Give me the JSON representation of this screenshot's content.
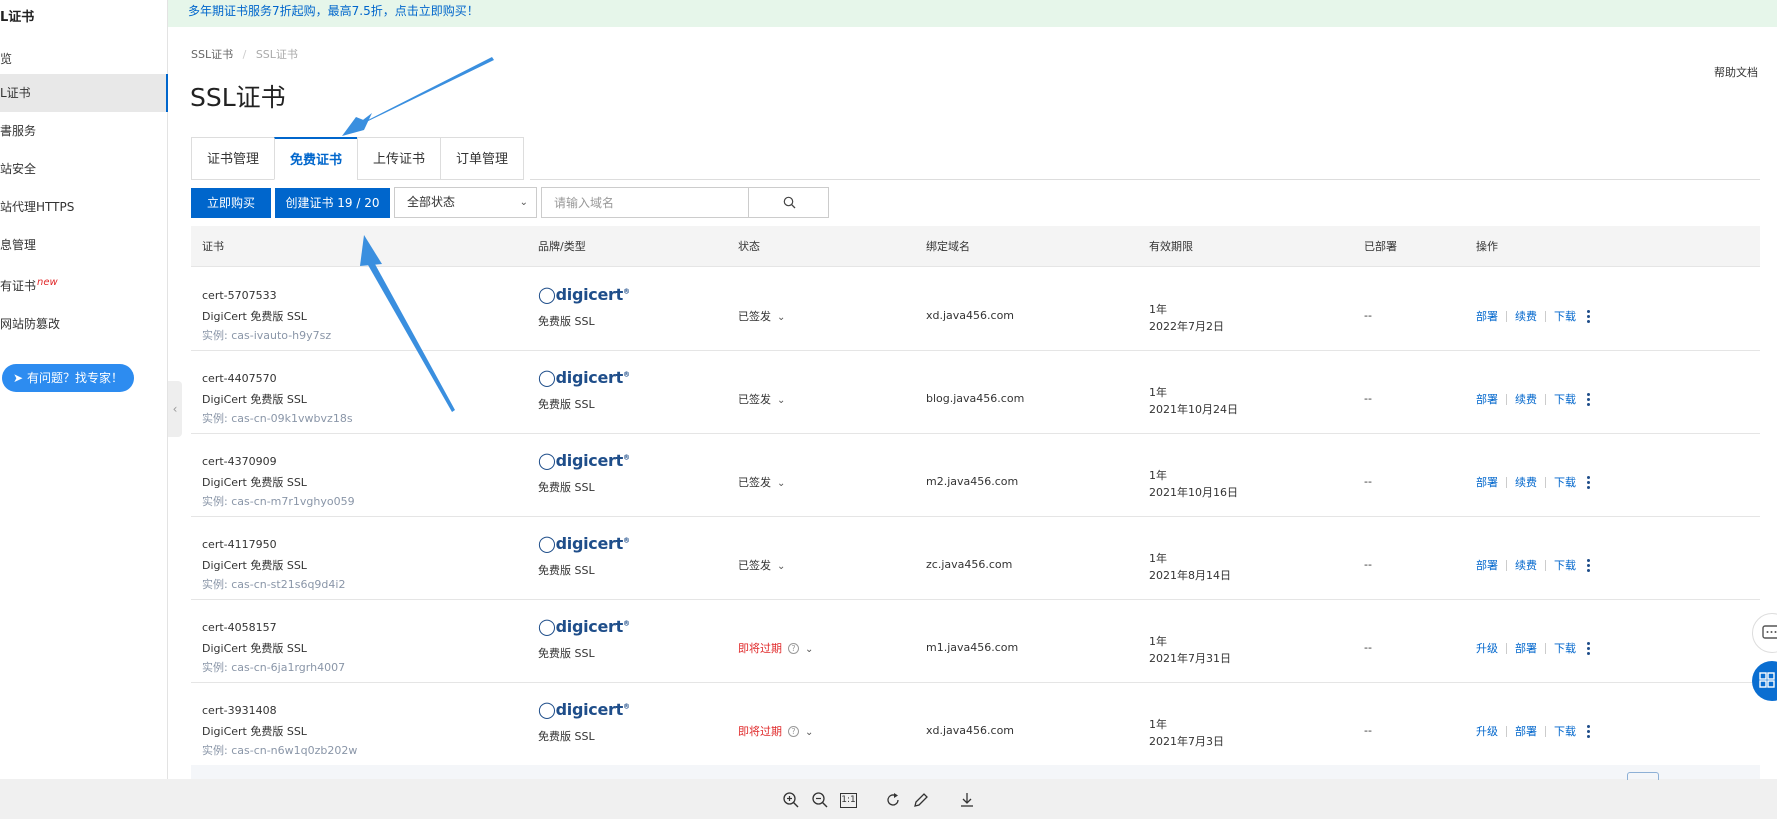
{
  "sidebar": {
    "title": "L证书",
    "items": [
      {
        "label": "览"
      },
      {
        "label": "L证书"
      },
      {
        "label": "書服务"
      },
      {
        "label": "站安全"
      },
      {
        "label": "站代理HTTPS"
      },
      {
        "label": "息管理"
      },
      {
        "label": "有证书",
        "badge": "new"
      },
      {
        "label": "网站防篡改"
      }
    ],
    "help_button": "有问题？找专家！"
  },
  "promo": {
    "text": "多年期证书服务7折起购，最高7.5折，点击立即购买！"
  },
  "breadcrumb": {
    "root": "SSL证书",
    "sep": "/",
    "current": "SSL证书"
  },
  "page": {
    "title": "SSL证书",
    "help_doc": "帮助文档"
  },
  "tabs": [
    {
      "label": "证书管理"
    },
    {
      "label": "免费证书"
    },
    {
      "label": "上传证书"
    },
    {
      "label": "订单管理"
    }
  ],
  "toolbar": {
    "buy_button": "立即购买",
    "create_button": "创建证书 19 / 20",
    "status_select": "全部状态",
    "search_placeholder": "请输入域名"
  },
  "table": {
    "headers": [
      "证书",
      "品牌/类型",
      "状态",
      "绑定域名",
      "有效期限",
      "已部署",
      "操作"
    ],
    "rows": [
      {
        "id": "cert-5707533",
        "brand": "DigiCert 免费版 SSL",
        "instance": "实例: cas-ivauto-h9y7sz",
        "logo": "digicert",
        "type": "免费版 SSL",
        "status": "已签发",
        "warn": false,
        "domain": "xd.java456.com",
        "period": "1年",
        "expiry": "2022年7月2日",
        "deployed": "--",
        "ops": [
          "部署",
          "续费",
          "下载"
        ]
      },
      {
        "id": "cert-4407570",
        "brand": "DigiCert 免费版 SSL",
        "instance": "实例: cas-cn-09k1vwbvz18s",
        "logo": "digicert",
        "type": "免费版 SSL",
        "status": "已签发",
        "warn": false,
        "domain": "blog.java456.com",
        "period": "1年",
        "expiry": "2021年10月24日",
        "deployed": "--",
        "ops": [
          "部署",
          "续费",
          "下载"
        ]
      },
      {
        "id": "cert-4370909",
        "brand": "DigiCert 免费版 SSL",
        "instance": "实例: cas-cn-m7r1vghyo059",
        "logo": "digicert",
        "type": "免费版 SSL",
        "status": "已签发",
        "warn": false,
        "domain": "m2.java456.com",
        "period": "1年",
        "expiry": "2021年10月16日",
        "deployed": "--",
        "ops": [
          "部署",
          "续费",
          "下载"
        ]
      },
      {
        "id": "cert-4117950",
        "brand": "DigiCert 免费版 SSL",
        "instance": "实例: cas-cn-st21s6q9d4i2",
        "logo": "digicert",
        "type": "免费版 SSL",
        "status": "已签发",
        "warn": false,
        "domain": "zc.java456.com",
        "period": "1年",
        "expiry": "2021年8月14日",
        "deployed": "--",
        "ops": [
          "部署",
          "续费",
          "下载"
        ]
      },
      {
        "id": "cert-4058157",
        "brand": "DigiCert 免费版 SSL",
        "instance": "实例: cas-cn-6ja1rgrh4007",
        "logo": "digicert",
        "type": "免费版 SSL",
        "status": "即将过期",
        "warn": true,
        "domain": "m1.java456.com",
        "period": "1年",
        "expiry": "2021年7月31日",
        "deployed": "--",
        "ops": [
          "升级",
          "部署",
          "下载"
        ]
      },
      {
        "id": "cert-3931408",
        "brand": "DigiCert 免费版 SSL",
        "instance": "实例: cas-cn-n6w1q0zb202w",
        "logo": "digicert",
        "type": "免费版 SSL",
        "status": "即将过期",
        "warn": true,
        "domain": "xd.java456.com",
        "period": "1年",
        "expiry": "2021年7月3日",
        "deployed": "--",
        "ops": [
          "升级",
          "部署",
          "下载"
        ]
      }
    ]
  },
  "viewer": {
    "icons": [
      "zoom-in-icon",
      "zoom-out-icon",
      "actual-size-icon",
      "rotate-icon",
      "edit-icon",
      "download-icon"
    ],
    "actual_size_label": "1:1"
  },
  "colors": {
    "primary": "#0066cc",
    "warn": "#e0292a",
    "promo_bg": "#e6f6ea",
    "arrow": "#3a8fdf"
  }
}
